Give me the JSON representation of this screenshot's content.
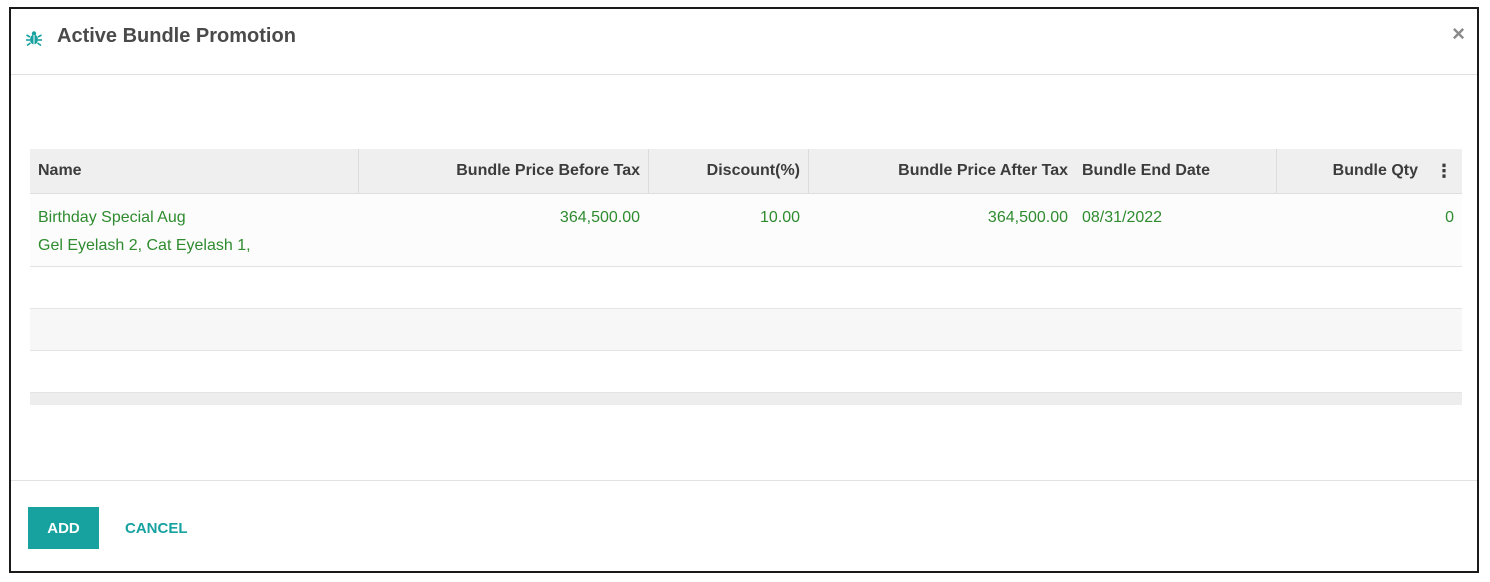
{
  "dialog": {
    "title": "Active Bundle Promotion",
    "close_glyph": "×",
    "icon": "bug-icon"
  },
  "table": {
    "headers": {
      "name": "Name",
      "price_before_tax": "Bundle Price Before Tax",
      "discount": "Discount(%)",
      "price_after_tax": "Bundle Price After Tax",
      "end_date": "Bundle End Date",
      "qty": "Bundle Qty",
      "menu_glyph": "⋮"
    },
    "rows": [
      {
        "name": "Birthday Special Aug",
        "items": "Gel Eyelash 2, Cat Eyelash 1,",
        "price_before_tax": "364,500.00",
        "discount": "10.00",
        "price_after_tax": "364,500.00",
        "end_date": "08/31/2022",
        "qty": "0"
      }
    ]
  },
  "footer": {
    "add_label": "ADD",
    "cancel_label": "CANCEL"
  },
  "colors": {
    "accent": "#17a2a0",
    "row_text": "#2e8b2e"
  }
}
